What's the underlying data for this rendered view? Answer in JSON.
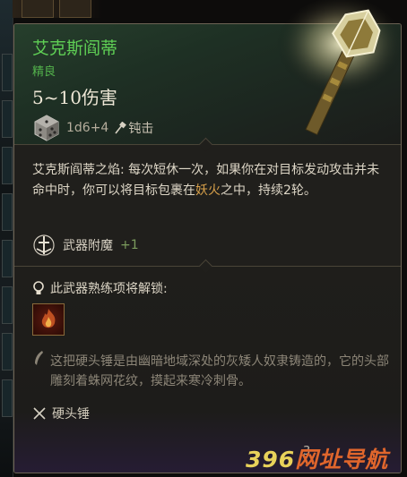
{
  "item": {
    "name": "艾克斯阎蒂",
    "rarity": "精良",
    "damage": "5~10伤害",
    "dice": "1d6+4",
    "damage_type": "钝击"
  },
  "description": {
    "feature_name": "艾克斯阎蒂之焰:",
    "text_part1": " 每次短休一次，如果你在对目标发动攻击并未命中时，你可以将目标包裹在",
    "highlight": "妖火",
    "text_part2": "之中，持续2轮。"
  },
  "enchantment": {
    "label": "武器附魔",
    "value": "+1"
  },
  "proficiency": {
    "label": "此武器熟练项将解锁:"
  },
  "lore": "这把硬头锤是由幽暗地域深处的灰矮人奴隶铸造的，它的头部雕刻着蛛网花纹，摸起来寒冷刺骨。",
  "weapon_type": "硬头锤",
  "bottom_number": "3",
  "watermark": {
    "num": "396",
    "text": "网址导航"
  },
  "colors": {
    "name": "#5fcf55",
    "rarity": "#53b24c",
    "highlight": "#d7a04a",
    "enchant_plus": "#7c9c5d",
    "panel_bg": "#201f1c",
    "header_bg": "#263f2c"
  },
  "icons": {
    "die": "d6-die-icon",
    "damage_type": "mace-icon",
    "enchant": "weapon-enchant-icon",
    "proficiency": "lightbulb-icon",
    "proficiency_action": "fire-action-icon",
    "lore": "quill-icon",
    "weapon_type": "crossed-weapons-icon"
  }
}
